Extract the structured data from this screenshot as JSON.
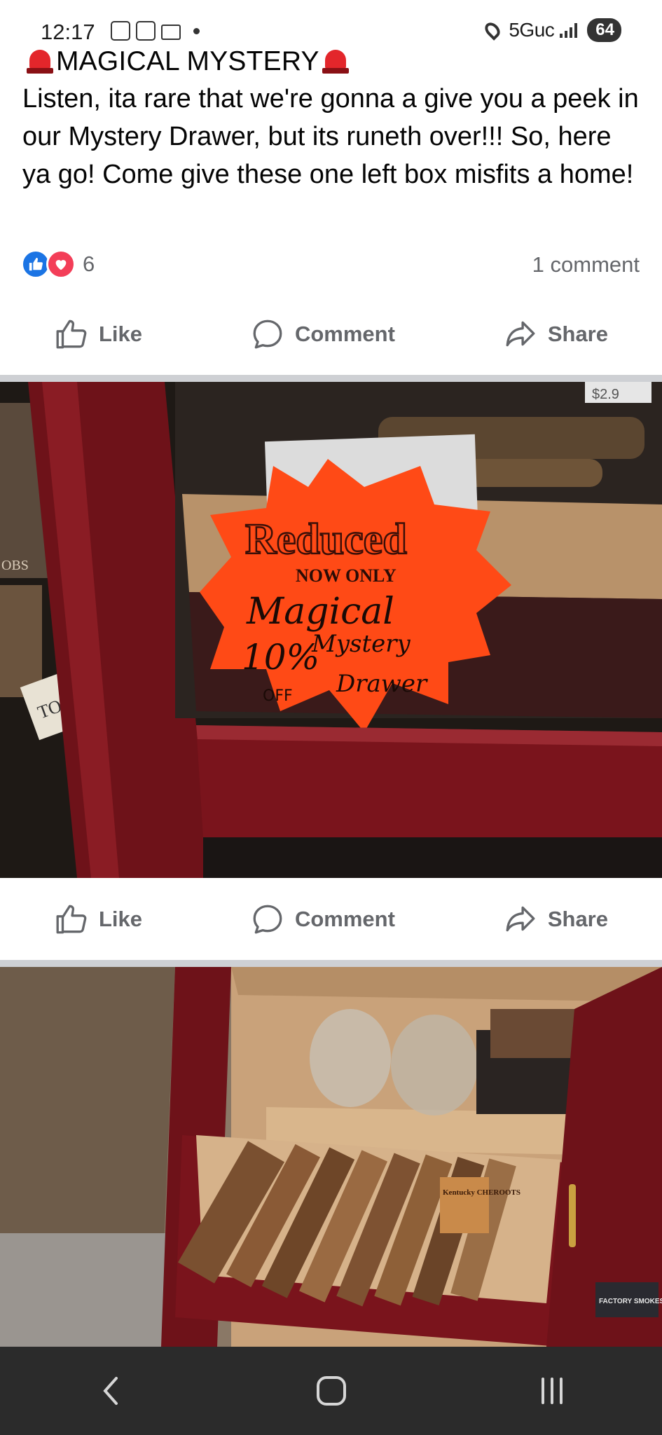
{
  "status_bar": {
    "time": "12:17",
    "network": "5Guc",
    "battery": "64",
    "icons": [
      "screenshot-icon",
      "teams-icon",
      "gmail-icon",
      "notification-dot",
      "location-icon",
      "signal-icon",
      "battery-icon"
    ]
  },
  "post": {
    "title": "MAGICAL MYSTERY",
    "body": "Listen, ita rare that we're gonna a give you a peek in our Mystery Drawer, but its runeth over!!! So, here ya go! Come give these one left box misfits a home!",
    "reaction_count": "6",
    "comment_count": "1 comment",
    "reaction_types": [
      "like",
      "love"
    ]
  },
  "actions": {
    "like": "Like",
    "comment": "Comment",
    "share": "Share"
  },
  "photo1": {
    "sign_title": "Reduced",
    "sign_subtitle": "NOW ONLY",
    "hand_line1": "Magical",
    "hand_percent": "10%",
    "hand_off": "OFF",
    "hand_line2": "Mystery",
    "hand_line3": "Drawer",
    "price_tag": "$2.9",
    "box_label_left": "OBS",
    "box_label_tor": "TOR",
    "sign_color": "#ff4a16"
  },
  "photo2": {
    "box_label": "Kentucky CHEROOTS",
    "factory_label": "FACTORY SMOKES"
  },
  "colors": {
    "accent_like": "#1b74e4",
    "accent_love": "#f33e58",
    "secondary_text": "#65676b",
    "divider": "#ced0d4",
    "nav_bg": "#2b2b2b",
    "cabinet_red": "#6e1219"
  }
}
